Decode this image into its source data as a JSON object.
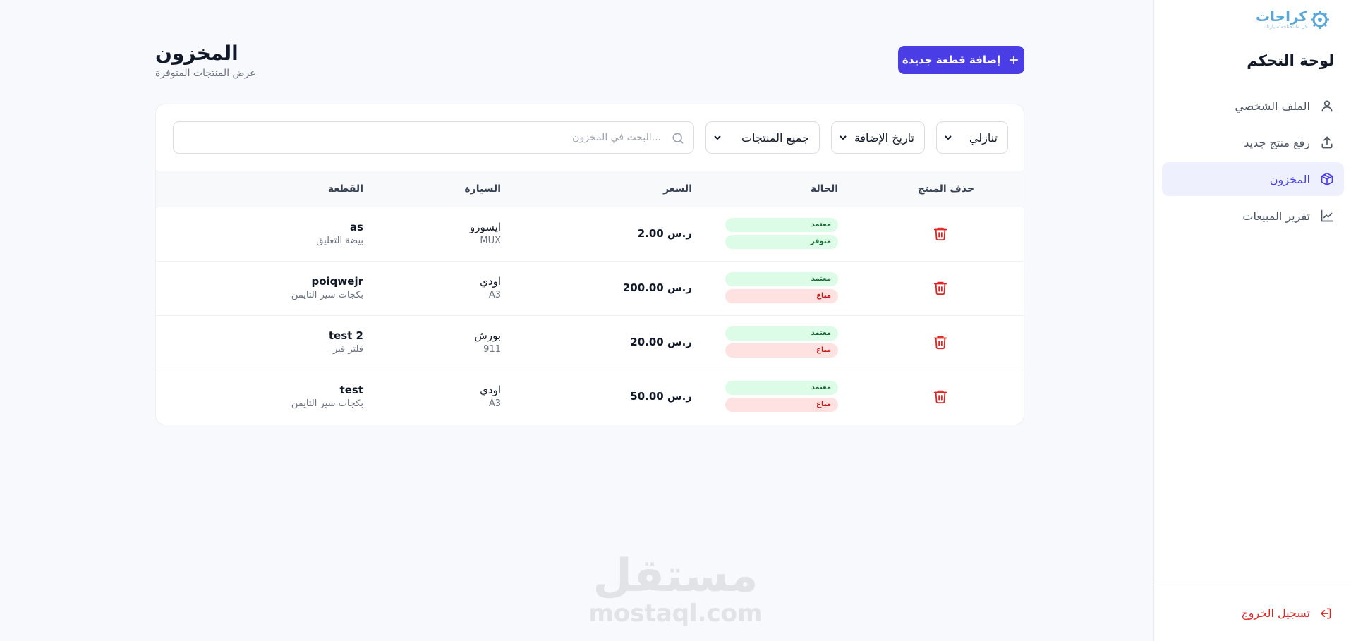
{
  "sidebar": {
    "logo": {
      "name": "كراجات",
      "tagline": "كل ما تحتاجه سيارتك"
    },
    "title": "لوحة التحكم",
    "items": [
      {
        "label": "الملف الشخصي",
        "icon": "user-icon",
        "active": false
      },
      {
        "label": "رفع منتج جديد",
        "icon": "upload-icon",
        "active": false
      },
      {
        "label": "المخزون",
        "icon": "box-icon",
        "active": true
      },
      {
        "label": "تقرير المبيعات",
        "icon": "chart-line-icon",
        "active": false
      }
    ],
    "logout_label": "تسجيل الخروج"
  },
  "header": {
    "title": "المخزون",
    "subtitle": "عرض المنتجات المتوفرة",
    "add_button_label": "إضافة قطعة جديدة"
  },
  "filters": {
    "search_placeholder": "...البحث في المخزون",
    "products_selected": "جميع المنتجات",
    "date_selected": "تاريخ الإضافة",
    "order_selected": "تنازلي"
  },
  "table": {
    "columns": {
      "part": "القطعة",
      "car": "السيارة",
      "price": "السعر",
      "status": "الحالة",
      "delete": "حذف المنتج"
    },
    "rows": [
      {
        "part": "as",
        "category": "بيضة التعليق",
        "car": "ايسوزو",
        "model": "MUX",
        "price": "ر.س 2.00",
        "approval": "معتمد",
        "availability": "متوفر",
        "availability_color": "green"
      },
      {
        "part": "poiqwejr",
        "category": "بكجات سير التايمن",
        "car": "اودي",
        "model": "A3",
        "price": "ر.س 200.00",
        "approval": "معتمد",
        "availability": "مباع",
        "availability_color": "red"
      },
      {
        "part": "test 2",
        "category": "فلتر قير",
        "car": "بورش",
        "model": "911",
        "price": "ر.س 20.00",
        "approval": "معتمد",
        "availability": "مباع",
        "availability_color": "red"
      },
      {
        "part": "test",
        "category": "بكجات سير التايمن",
        "car": "اودي",
        "model": "A3",
        "price": "ر.س 50.00",
        "approval": "معتمد",
        "availability": "مباع",
        "availability_color": "red"
      }
    ]
  },
  "watermark": {
    "arabic": "مستقل",
    "latin": "mostaql.com"
  },
  "colors": {
    "primary": "#4a3de6",
    "danger": "#dc2626",
    "badge_green_bg": "#dcfce7",
    "badge_red_bg": "#fee2e2",
    "logo": "#5aa6d6"
  }
}
